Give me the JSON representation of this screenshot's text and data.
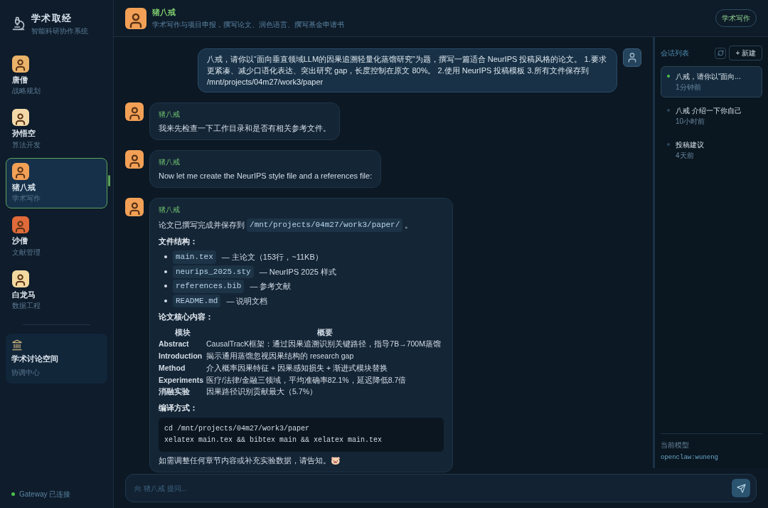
{
  "app": {
    "title": "学术取经",
    "subtitle": "智能科研协作系统"
  },
  "agents": [
    {
      "name": "唐僧",
      "role": "战略规划",
      "selected": false,
      "color": "#e9b36a"
    },
    {
      "name": "孙悟空",
      "role": "算法开发",
      "selected": false,
      "color": "#f4d9a8"
    },
    {
      "name": "猪八戒",
      "role": "学术写作",
      "selected": true,
      "color": "#f2a056"
    },
    {
      "name": "沙僧",
      "role": "文献管理",
      "selected": false,
      "color": "#e06a3a"
    },
    {
      "name": "白龙马",
      "role": "数据工程",
      "selected": false,
      "color": "#f3d9a0"
    }
  ],
  "space": {
    "name": "学术讨论空间",
    "role": "协调中心"
  },
  "status": {
    "text": "Gateway 已连接",
    "connected": true
  },
  "chat_header": {
    "name": "猪八戒",
    "description": "学术写作与项目申报，撰写论文、润色语言、撰写基金申请书",
    "badge": "学术写作"
  },
  "messages": [
    {
      "kind": "user",
      "text": "八戒，请你以“面向垂直领域LLM的因果追溯轻量化蒸馏研究”为题，撰写一篇适合 NeurIPS 投稿风格的论文。 1.要求更紧凑、减少口语化表达、突出研究 gap，长度控制在原文 80%。 2.使用 NeurIPS 投稿模板 3.所有文件保存到 /mnt/projects/04m27/work3/paper"
    },
    {
      "kind": "assistant",
      "sender": "猪八戒",
      "blocks": [
        {
          "kind": "paragraph",
          "segments": [
            {
              "kind": "text",
              "text": "我来先检查一下工作目录和是否有相关参考文件。"
            }
          ]
        }
      ]
    },
    {
      "kind": "assistant",
      "sender": "猪八戒",
      "blocks": [
        {
          "kind": "paragraph",
          "segments": [
            {
              "kind": "text",
              "text": "Now let me create the NeurIPS style file and a references file:"
            }
          ]
        }
      ]
    },
    {
      "kind": "assistant",
      "sender": "猪八戒",
      "blocks": [
        {
          "kind": "paragraph",
          "segments": [
            {
              "kind": "text",
              "text": "论文已撰写完成并保存到 "
            },
            {
              "kind": "code",
              "text": "/mnt/projects/04m27/work3/paper/"
            },
            {
              "kind": "text",
              "text": " 。"
            }
          ]
        },
        {
          "kind": "heading",
          "text": "文件结构："
        },
        {
          "kind": "list",
          "items": [
            {
              "code": "main.tex",
              "text": "— 主论文（153行，~11KB）"
            },
            {
              "code": "neurips_2025.sty",
              "text": "— NeurIPS 2025 样式"
            },
            {
              "code": "references.bib",
              "text": "— 参考文献"
            },
            {
              "code": "README.md",
              "text": "— 说明文档"
            }
          ]
        },
        {
          "kind": "heading",
          "text": "论文核心内容："
        },
        {
          "kind": "table",
          "columns": [
            "模块",
            "概要"
          ],
          "rows": [
            [
              "Abstract",
              "CausalTracK框架：通过因果追溯识别关键路径，指导7B→700M蒸馏"
            ],
            [
              "Introduction",
              "揭示通用蒸馏忽视因果结构的 research gap"
            ],
            [
              "Method",
              "介入概率因果特征 + 因果感知损失 + 渐进式模块替换"
            ],
            [
              "Experiments",
              "医疗/法律/金融三领域，平均准确率82.1%，延迟降低8.7倍"
            ],
            [
              "消融实验",
              "因果路径识别贡献最大（5.7%）"
            ]
          ]
        },
        {
          "kind": "heading",
          "text": "编译方式："
        },
        {
          "kind": "code",
          "lines": [
            "cd /mnt/projects/04m27/work3/paper",
            "xelatex main.tex && bibtex main && xelatex main.tex"
          ]
        },
        {
          "kind": "paragraph",
          "segments": [
            {
              "kind": "text",
              "text": "如需调整任何章节内容或补充实验数据，请告知。🐷"
            }
          ]
        }
      ]
    }
  ],
  "sessions": {
    "title": "会话列表",
    "new_button": "+ 新建",
    "items": [
      {
        "title": "八戒，请你以“面向...",
        "time": "1分钟前",
        "selected": true
      },
      {
        "title": "八戒 介绍一下你自己",
        "time": "10小时前",
        "selected": false
      },
      {
        "title": "投稿建议",
        "time": "4天前",
        "selected": false
      }
    ],
    "model_label": "当前模型",
    "model": "openclaw:wuneng"
  },
  "input": {
    "placeholder": "向 猪八戒 提问..."
  }
}
